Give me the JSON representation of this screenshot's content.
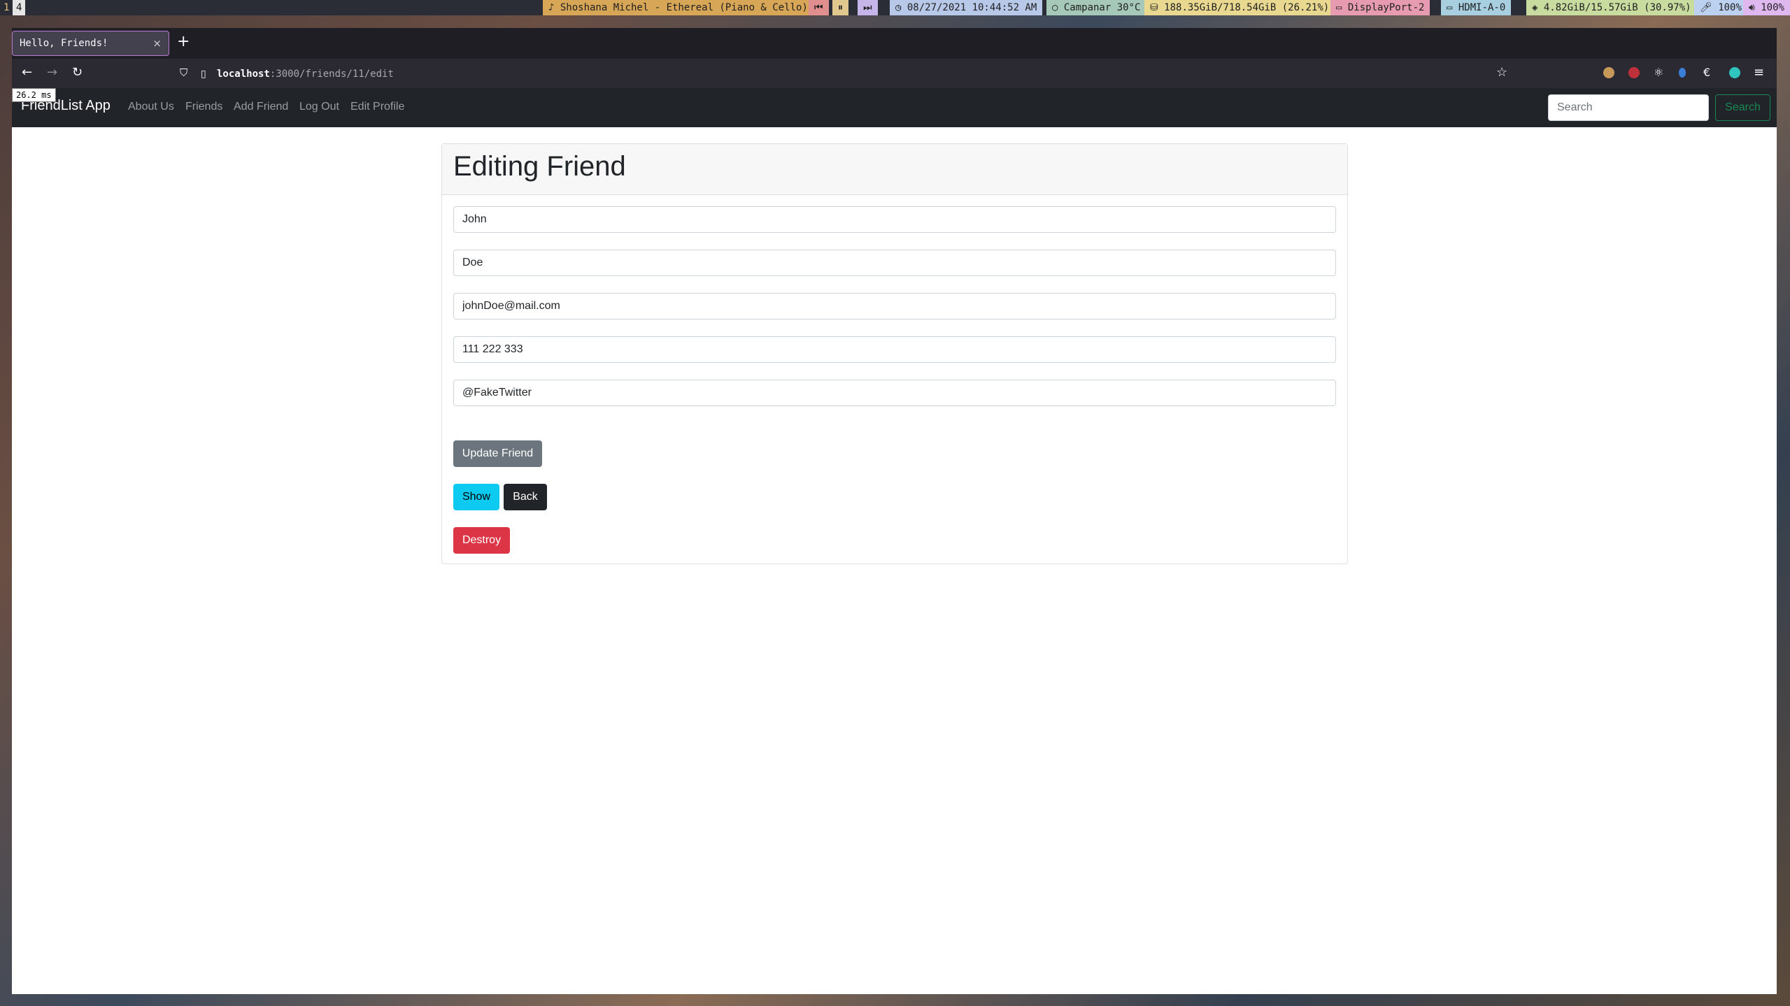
{
  "statusbar": {
    "workspaces": [
      "1",
      "4"
    ],
    "music": "Shoshana Michel - Ethereal (Piano & Cello)",
    "datetime": "08/27/2021 10:44:52 AM",
    "weather": "Campanar 30°C",
    "disk": "188.35GiB/718.54GiB (26.21%)",
    "display1": "DisplayPort-2",
    "display2": "HDMI-A-0",
    "memory": "4.82GiB/15.57GiB (30.97%)",
    "mic": "100%",
    "volume": "100%"
  },
  "browser": {
    "tab_title": "Hello, Friends!",
    "url_host": "localhost",
    "url_path": ":3000/friends/11/edit",
    "render_time": "26.2 ms"
  },
  "app": {
    "brand": "FriendList App",
    "nav": [
      "About Us",
      "Friends",
      "Add Friend",
      "Log Out",
      "Edit Profile"
    ],
    "search_placeholder": "Search",
    "search_button": "Search"
  },
  "form": {
    "title": "Editing Friend",
    "first_name": "John",
    "last_name": "Doe",
    "email": "johnDoe@mail.com",
    "phone": "111 222 333",
    "twitter": "@FakeTwitter",
    "update_label": "Update Friend",
    "show_label": "Show",
    "back_label": "Back",
    "destroy_label": "Destroy"
  },
  "colors": {
    "navbar": "#212529",
    "search_outline": "#198754",
    "update": "#6c757d",
    "show": "#0dcaf0",
    "back": "#212529",
    "destroy": "#dc3545"
  }
}
